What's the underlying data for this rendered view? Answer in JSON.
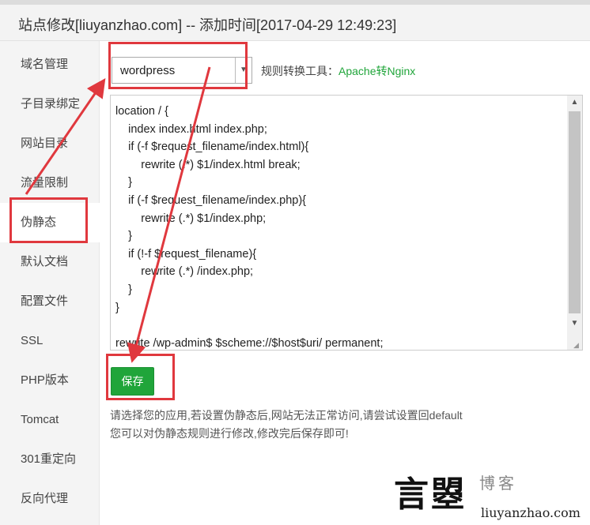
{
  "dialog": {
    "title": "站点修改[liuyanzhao.com] -- 添加时间[2017-04-29 12:49:23]"
  },
  "sidebar": {
    "items": [
      {
        "label": "域名管理"
      },
      {
        "label": "子目录绑定"
      },
      {
        "label": "网站目录"
      },
      {
        "label": "流量限制"
      },
      {
        "label": "伪静态"
      },
      {
        "label": "默认文档"
      },
      {
        "label": "配置文件"
      },
      {
        "label": "SSL"
      },
      {
        "label": "PHP版本"
      },
      {
        "label": "Tomcat"
      },
      {
        "label": "301重定向"
      },
      {
        "label": "反向代理"
      }
    ],
    "active_index": 4
  },
  "rewrite": {
    "selected": "wordpress",
    "tool_label": "规则转换工具：",
    "tool_link": "Apache转Nginx",
    "code": "location / {\n\tindex index.html index.php;\n\tif (-f $request_filename/index.html){\n\t\trewrite (.*) $1/index.html break;\n\t}\n\tif (-f $request_filename/index.php){\n\t\trewrite (.*) $1/index.php;\n\t}\n\tif (!-f $request_filename){\n\t\trewrite (.*) /index.php;\n\t}\n}\n\nrewrite /wp-admin$ $scheme://$host$uri/ permanent;",
    "save_label": "保存",
    "help_line1": "请选择您的应用,若设置伪静态后,网站无法正常访问,请尝试设置回default",
    "help_line2": "您可以对伪静态规则进行修改,修改完后保存即可!"
  },
  "watermark": {
    "big": "言曌",
    "small": "博客",
    "url": "liuyanzhao.com"
  },
  "colors": {
    "accent": "#20a53a",
    "annotation": "#e0383e"
  },
  "icons": {
    "select_arrow": "chevron-down-icon",
    "scroll_up": "arrow-up-icon",
    "scroll_down": "arrow-down-icon"
  }
}
